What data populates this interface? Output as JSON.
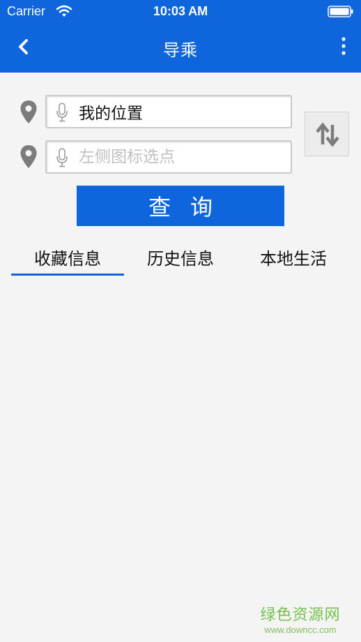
{
  "status_bar": {
    "carrier": "Carrier",
    "time": "10:03 AM",
    "wifi_icon": "wifi-icon",
    "battery_icon": "battery-icon"
  },
  "nav": {
    "title": "导乘",
    "back_icon": "chevron-left-icon",
    "more_icon": "more-vertical-icon"
  },
  "search": {
    "origin_value": "我的位置",
    "origin_placeholder": "",
    "destination_value": "",
    "destination_placeholder": "左侧图标选点",
    "pin_icon": "location-pin-icon",
    "mic_icon": "microphone-icon",
    "swap_icon": "swap-arrows-icon",
    "query_label": "查询"
  },
  "tabs": [
    {
      "label": "收藏信息",
      "active": true
    },
    {
      "label": "历史信息",
      "active": false
    },
    {
      "label": "本地生活",
      "active": false
    }
  ],
  "watermark": {
    "title": "绿色资源网",
    "url": "www.downcc.com"
  },
  "colors": {
    "primary": "#0f65dc",
    "background": "#f4f4f4",
    "icon_gray": "#7c7c7c",
    "watermark_green": "#74c14b"
  }
}
